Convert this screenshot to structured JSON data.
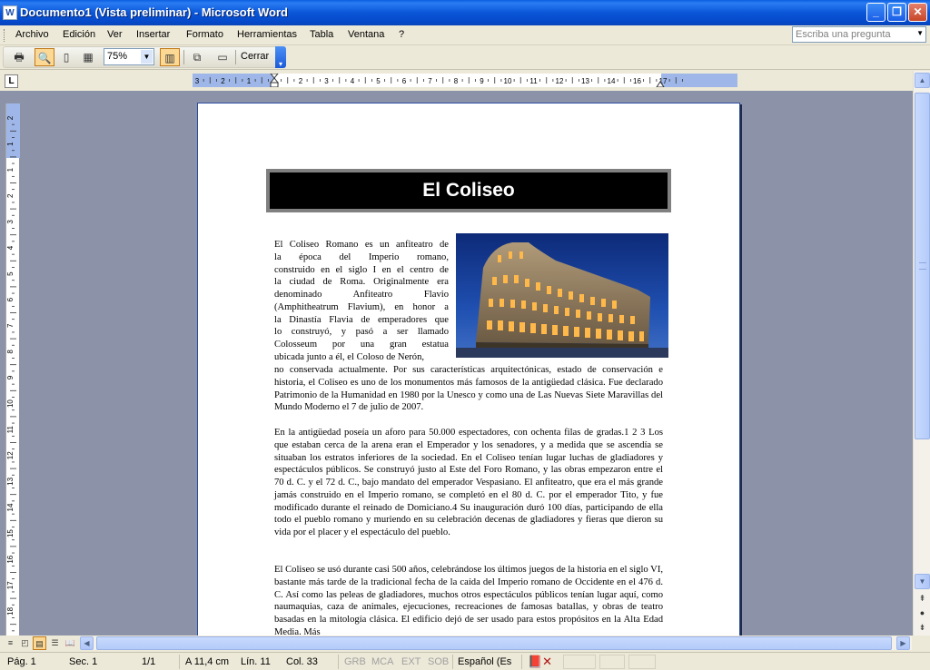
{
  "window": {
    "title": "Documento1 (Vista preliminar) - Microsoft Word",
    "minimize": "_",
    "maximize": "❐",
    "close": "✕"
  },
  "menu": {
    "items": [
      "Archivo",
      "Edición",
      "Ver",
      "Insertar",
      "Formato",
      "Herramientas",
      "Tabla",
      "Ventana",
      "?"
    ],
    "ask_placeholder": "Escriba una pregunta"
  },
  "toolbar": {
    "zoom_value": "75%",
    "close_label": "Cerrar"
  },
  "ruler": {
    "h_labels": [
      "3",
      "2",
      "1",
      "1",
      "2",
      "3",
      "4",
      "5",
      "6",
      "7",
      "8",
      "9",
      "10",
      "11",
      "12",
      "13",
      "14",
      "16",
      "17"
    ],
    "v_labels": [
      "2",
      "1",
      "1",
      "2",
      "3",
      "4",
      "5",
      "6",
      "7",
      "8",
      "9",
      "10",
      "11",
      "12",
      "13",
      "14",
      "15",
      "16",
      "17",
      "18"
    ]
  },
  "document": {
    "title": "El Coliseo",
    "image_alt": "Coliseo Romano de noche",
    "para1_wrapped_lines": [
      "El Coliseo Romano es un anfiteatro de",
      "la época del Imperio romano,",
      "construido en el siglo I en el centro de",
      "la ciudad de Roma. Originalmente era",
      "denominado Anfiteatro Flavio",
      "(Amphitheatrum Flavium), en honor a",
      "la Dinastía Flavia de emperadores que",
      "lo construyó, y pasó a ser llamado",
      "Colosseum por una gran estatua",
      "ubicada junto a él, el Coloso de Nerón,"
    ],
    "para1_continuation": "no conservada actualmente. Por sus características arquitectónicas, estado de conservación e historia, el Coliseo es uno de los monumentos más famosos de la antigüedad clásica. Fue declarado Patrimonio de la Humanidad en 1980 por la Unesco y como una de Las Nuevas Siete Maravillas del Mundo Moderno el 7 de julio de 2007.",
    "para2": "En la antigüedad poseía un aforo para 50.000 espectadores, con ochenta filas de gradas.1 2 3 Los que estaban cerca de la arena eran el Emperador y los senadores, y a medida que se ascendía se situaban los estratos inferiores de la sociedad. En el Coliseo tenían lugar luchas de gladiadores y espectáculos públicos. Se construyó justo al Este del Foro Romano, y las obras empezaron entre el 70 d. C. y el 72 d. C., bajo mandato del emperador Vespasiano. El anfiteatro, que era el más grande jamás construido en el Imperio romano, se completó en el 80 d. C. por el emperador Tito, y fue modificado durante el reinado de Domiciano.4 Su inauguración duró 100 días, participando de ella todo el pueblo romano y muriendo en su celebración decenas de gladiadores y fieras que dieron su vida por el placer y el espectáculo del pueblo.",
    "para3": "El Coliseo se usó durante casi 500 años, celebrándose los últimos juegos de la historia en el siglo VI, bastante más tarde de la tradicional fecha de la caída del Imperio romano de Occidente en el 476 d. C. Así como las peleas de gladiadores, muchos otros espectáculos públicos tenían lugar aquí, como naumaquias, caza de animales, ejecuciones, recreaciones de famosas batallas, y obras de teatro basadas en la mitología clásica. El edificio dejó de ser usado para estos propósitos en la Alta Edad Media. Más"
  },
  "status": {
    "page": "Pág.  1",
    "section": "Sec.  1",
    "pages": "1/1",
    "at": "A  11,4 cm",
    "line": "Lín.  11",
    "col": "Col.  33",
    "grb": "GRB",
    "mca": "MCA",
    "ext": "EXT",
    "sob": "SOB",
    "language": "Español (Es"
  },
  "colors": {
    "titlebar": "#0a56d8",
    "doc_background": "#8c93a8",
    "title_box": "#000000",
    "title_border": "#808080"
  }
}
